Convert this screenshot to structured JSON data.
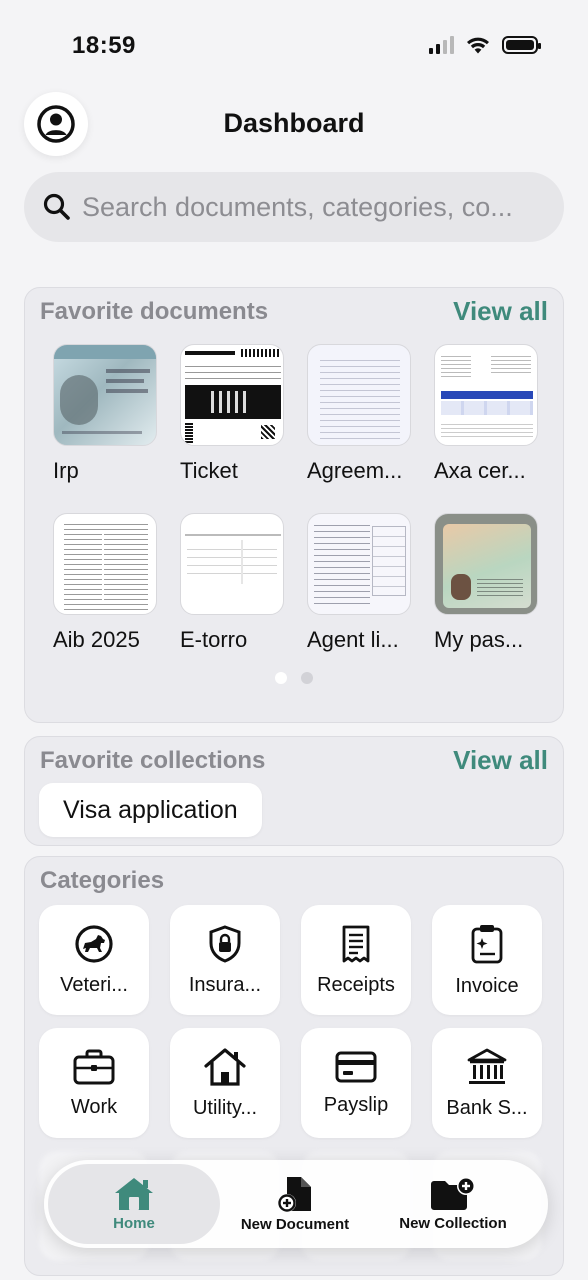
{
  "status": {
    "time": "18:59"
  },
  "header": {
    "title": "Dashboard"
  },
  "search": {
    "placeholder": "Search documents, categories, co..."
  },
  "favorites": {
    "title": "Favorite documents",
    "view_all": "View all",
    "documents": [
      {
        "label": "Irp",
        "thumb": "residence-permit"
      },
      {
        "label": "Ticket",
        "thumb": "event-ticket"
      },
      {
        "label": "Agreem...",
        "thumb": "text-document"
      },
      {
        "label": "Axa cer...",
        "thumb": "certificate"
      },
      {
        "label": "Aib 2025",
        "thumb": "statement"
      },
      {
        "label": "E-torro",
        "thumb": "report"
      },
      {
        "label": "Agent li...",
        "thumb": "form"
      },
      {
        "label": "My pas...",
        "thumb": "passport"
      }
    ],
    "page": 1,
    "pages": 2
  },
  "collections": {
    "title": "Favorite collections",
    "view_all": "View all",
    "items": [
      "Visa application"
    ]
  },
  "categories": {
    "title": "Categories",
    "items": [
      {
        "label": "Veteri...",
        "icon": "dog-icon"
      },
      {
        "label": "Insura...",
        "icon": "shield-lock-icon"
      },
      {
        "label": "Receipts",
        "icon": "receipt-icon"
      },
      {
        "label": "Invoice",
        "icon": "clipboard-icon"
      },
      {
        "label": "Work",
        "icon": "briefcase-icon"
      },
      {
        "label": "Utility...",
        "icon": "house-icon"
      },
      {
        "label": "Payslip",
        "icon": "credit-card-icon"
      },
      {
        "label": "Bank S...",
        "icon": "bank-icon"
      }
    ]
  },
  "tabbar": {
    "home": "Home",
    "new_document": "New Document",
    "new_collection": "New Collection",
    "accent": "#3f8a7c"
  }
}
